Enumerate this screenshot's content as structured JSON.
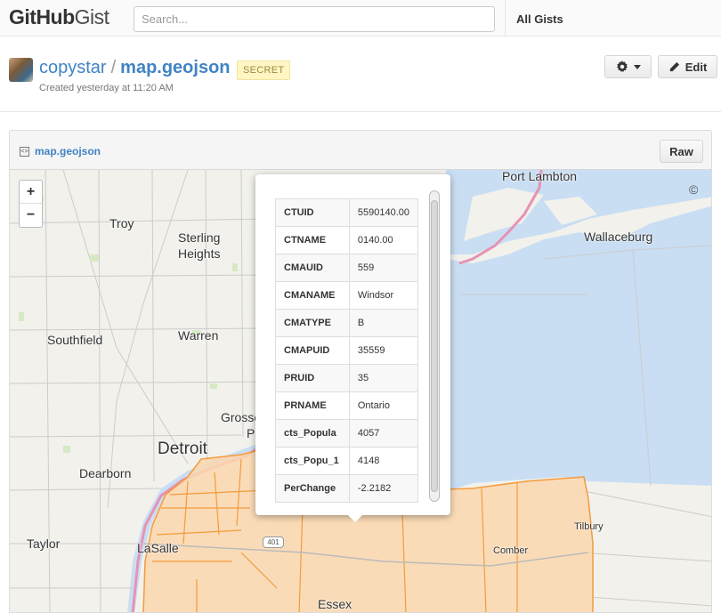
{
  "topbar": {
    "logo_bold": "GitHub",
    "logo_light": "Gist",
    "search_placeholder": "Search...",
    "all_gists": "All Gists"
  },
  "gist": {
    "owner": "copystar",
    "separator": "/",
    "filename": "map.geojson",
    "visibility": "SECRET",
    "created": "Created yesterday at 11:20 AM",
    "edit_label": "Edit"
  },
  "file": {
    "name": "map.geojson",
    "raw_label": "Raw",
    "icon_glyph": "<>"
  },
  "map": {
    "zoom_in": "+",
    "zoom_out": "−",
    "attribution": "©",
    "highway_shield": "401",
    "labels": {
      "port_lambton": "Port Lambton",
      "troy": "Troy",
      "sterling": "Sterling",
      "heights": "Heights",
      "wallaceburg": "Wallaceburg",
      "southfield": "Southfield",
      "warren": "Warren",
      "grosse": "Grosse",
      "grosse_p": "P",
      "detroit": "Detroit",
      "dearborn": "Dearborn",
      "taylor": "Taylor",
      "lasalle": "LaSalle",
      "comber": "Comber",
      "tilbury": "Tilbury",
      "essex": "Essex"
    },
    "colors": {
      "water": "#c9def3",
      "land": "#f2f1ec",
      "region_fill": "#fbd7ae",
      "region_stroke": "#f39b3c",
      "border_line": "#e693b4"
    }
  },
  "popup": {
    "rows": [
      {
        "key": "CTUID",
        "value": "5590140.00"
      },
      {
        "key": "CTNAME",
        "value": "0140.00"
      },
      {
        "key": "CMAUID",
        "value": "559"
      },
      {
        "key": "CMANAME",
        "value": "Windsor"
      },
      {
        "key": "CMATYPE",
        "value": "B"
      },
      {
        "key": "CMAPUID",
        "value": "35559"
      },
      {
        "key": "PRUID",
        "value": "35"
      },
      {
        "key": "PRNAME",
        "value": "Ontario"
      },
      {
        "key": "cts_Popula",
        "value": "4057"
      },
      {
        "key": "cts_Popu_1",
        "value": "4148"
      },
      {
        "key": "PerChange",
        "value": "-2.2182"
      }
    ]
  }
}
